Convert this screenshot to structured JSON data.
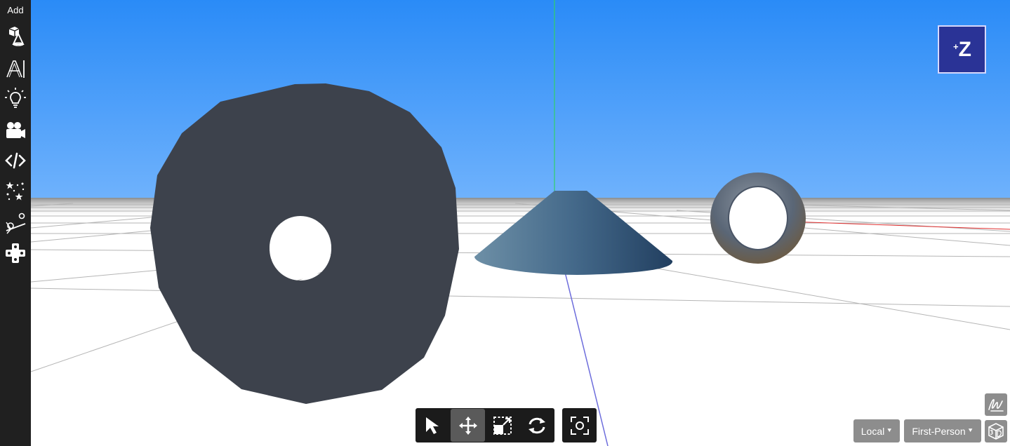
{
  "sidebar": {
    "title": "Add",
    "tools": [
      {
        "name": "add-shapes-icon"
      },
      {
        "name": "add-text-icon"
      },
      {
        "name": "add-light-icon"
      },
      {
        "name": "add-camera-icon"
      },
      {
        "name": "add-code-icon"
      },
      {
        "name": "add-effects-icon"
      },
      {
        "name": "add-physics-icon"
      },
      {
        "name": "add-controls-icon"
      }
    ]
  },
  "viewcube": {
    "sign": "+",
    "axis": "Z",
    "color": "#2a3396"
  },
  "toolbar": {
    "transform_tools": [
      "select-arrow-icon",
      "move-arrows-icon",
      "scale-icon",
      "rotate-icon"
    ],
    "active_tool": "move-arrows-icon",
    "focus_tool": "focus-frame-icon"
  },
  "space_mode": {
    "label": "Local"
  },
  "camera_mode": {
    "label": "First-Person"
  },
  "colors": {
    "sky_top": "#2a8cf7",
    "sky_horizon": "#6fb2fc",
    "disc": "#3d424c",
    "cone_light": "#6a8ea8",
    "cone_dark": "#244463",
    "torus": "#5f6d7c",
    "axis_x": "#e03030",
    "axis_y": "#2fd06a",
    "axis_z": "#6d6ddc",
    "sidebar_bg": "#202020",
    "toolbar_bg": "#1b1b1b",
    "control_bg": "#8d8d8d"
  }
}
